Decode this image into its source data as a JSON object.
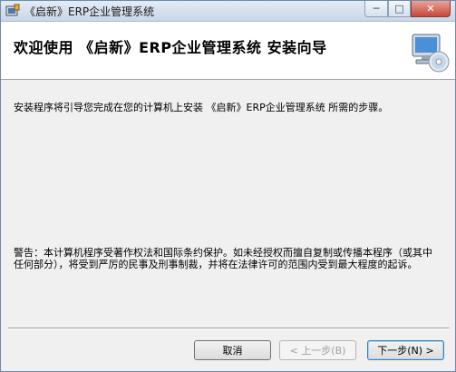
{
  "window": {
    "title": "《启新》ERP企业管理系统",
    "controls": {
      "minimize": "─",
      "maximize": "□",
      "close": "✕"
    }
  },
  "header": {
    "title": "欢迎使用 《启新》ERP企业管理系统 安装向导",
    "graphic_icon": "computer-cd-setup-icon"
  },
  "content": {
    "intro": "安装程序将引导您完成在您的计算机上安装 《启新》ERP企业管理系统 所需的步骤。",
    "warning": "警告：本计算机程序受著作权法和国际条约保护。如未经授权而擅自复制或传播本程序（或其中任何部分），将受到严厉的民事及刑事制裁，并将在法律许可的范围内受到最大程度的起诉。"
  },
  "buttons": {
    "cancel": "取消",
    "back": "< 上一步(B)",
    "next": "下一步(N) >"
  }
}
